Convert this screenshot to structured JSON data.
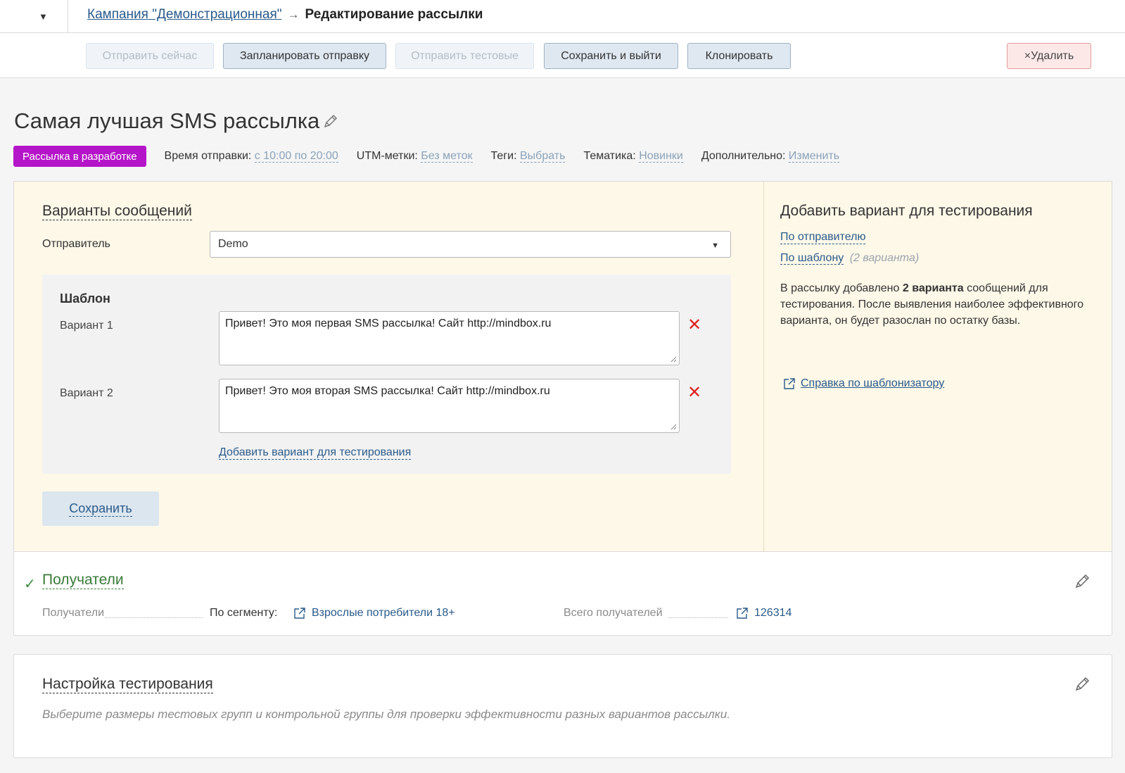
{
  "header": {
    "toggle_glyph": "▼",
    "breadcrumb_campaign": "Кампания \"Демонстрационная\"",
    "breadcrumb_arrow": "→",
    "breadcrumb_current": "Редактирование рассылки"
  },
  "toolbar": {
    "send_now": "Отправить сейчас",
    "schedule": "Запланировать отправку",
    "send_test": "Отправить тестовые",
    "save_exit": "Сохранить и выйти",
    "clone": "Клонировать",
    "delete": "×Удалить"
  },
  "page": {
    "title": "Самая лучшая SMS рассылка",
    "status_badge": "Рассылка в разработке",
    "meta": {
      "send_time_label": "Время отправки:",
      "send_time_value": "с 10:00 по 20:00",
      "utm_label": "UTM-метки:",
      "utm_value": "Без меток",
      "tags_label": "Теги:",
      "tags_value": "Выбрать",
      "topic_label": "Тематика:",
      "topic_value": "Новинки",
      "extra_label": "Дополнительно:",
      "extra_value": "Изменить"
    }
  },
  "variants": {
    "title": "Варианты сообщений",
    "sender_label": "Отправитель",
    "sender_value": "Demo",
    "template_title": "Шаблон",
    "items": [
      {
        "label": "Вариант 1",
        "text": "Привет! Это моя первая SMS рассылка! Сайт http://mindbox.ru"
      },
      {
        "label": "Вариант 2",
        "text": "Привет! Это моя вторая SMS рассылка! Сайт http://mindbox.ru"
      }
    ],
    "delete_glyph": "✕",
    "add_variant": "Добавить вариант для тестирования",
    "save": "Сохранить"
  },
  "sidebar": {
    "title": "Добавить вариант для тестирования",
    "by_sender": "По отправителю",
    "by_template": "По шаблону",
    "by_template_hint": "(2 варианта)",
    "desc_before": "В рассылку добавлено ",
    "desc_bold": "2 варианта",
    "desc_after": " сообщений для тестирования. После выявления наиболее эффективного варианта, он будет разослан по остатку базы.",
    "help_link": "Справка по шаблонизатору"
  },
  "recipients": {
    "check_glyph": "✓",
    "title": "Получатели",
    "label": "Получатели",
    "segment_label": "По сегменту:",
    "segment_value": "Взрослые потребители 18+",
    "total_label": "Всего получателей",
    "total_value": "126314"
  },
  "testing": {
    "title": "Настройка тестирования",
    "description": "Выберите размеры тестовых групп и контрольной группы для проверки эффективности разных вариантов рассылки."
  },
  "colors": {
    "status_badge": "#b515c8",
    "panel_bg": "#fdf8e8",
    "link": "#2a5a8a",
    "delete_x": "#e02020",
    "done_green": "#3a8a3a"
  }
}
